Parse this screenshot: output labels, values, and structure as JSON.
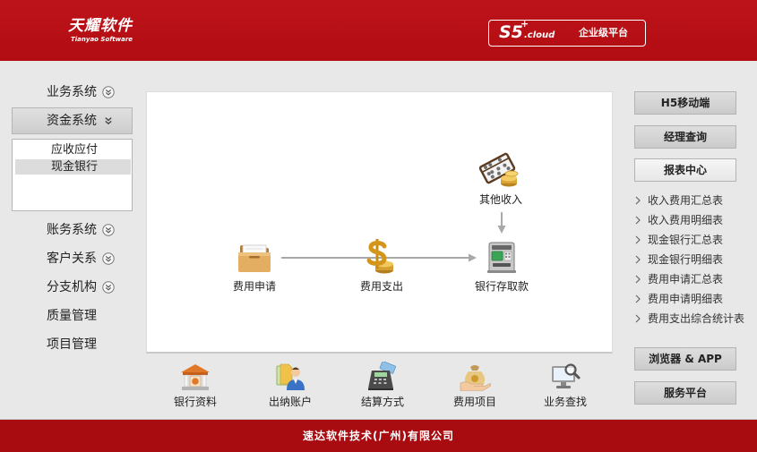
{
  "colors": {
    "brand_red": "#b10d12",
    "footer_red": "#a80c10",
    "body_bg": "#e8e8e8",
    "arrow": "#a9a9a9"
  },
  "header": {
    "logo": {
      "title": "天耀软件",
      "subtitle": "Tianyao Software"
    },
    "badge": {
      "product": "S5",
      "superscript": "+",
      "suffix": ".cloud",
      "tagline": "企业级平台"
    }
  },
  "sidebar": {
    "items": [
      {
        "label": "业务系统",
        "icon": "chevron-circle-down-icon"
      },
      {
        "label": "资金系统",
        "icon": "double-chevron-down-icon",
        "active": true
      },
      {
        "label": "账务系统",
        "icon": "chevron-circle-down-icon"
      },
      {
        "label": "客户关系",
        "icon": "chevron-circle-down-icon"
      },
      {
        "label": "分支机构",
        "icon": "chevron-circle-down-icon"
      },
      {
        "label": "质量管理"
      },
      {
        "label": "项目管理"
      }
    ],
    "submenu": [
      {
        "label": "应收应付"
      },
      {
        "label": "现金银行",
        "selected": true
      }
    ]
  },
  "flow": {
    "nodes": [
      {
        "label": "费用申请",
        "icon": "folder-icon"
      },
      {
        "label": "费用支出",
        "icon": "dollar-coins-icon"
      },
      {
        "label": "银行存取款",
        "icon": "atm-icon"
      },
      {
        "label": "其他收入",
        "icon": "abacus-coins-icon"
      }
    ],
    "edges": [
      {
        "from": 0,
        "via": 1,
        "to": 2
      },
      {
        "from": 3,
        "to": 2
      }
    ]
  },
  "shortcuts": [
    {
      "label": "银行资料",
      "icon": "bank-building-icon"
    },
    {
      "label": "出纳账户",
      "icon": "cashier-icon"
    },
    {
      "label": "结算方式",
      "icon": "card-terminal-icon"
    },
    {
      "label": "费用项目",
      "icon": "money-bag-icon"
    },
    {
      "label": "业务查找",
      "icon": "computer-search-icon"
    }
  ],
  "right_panel": {
    "top_buttons": [
      {
        "label": "H5移动端"
      },
      {
        "label": "经理查询"
      }
    ],
    "reports": {
      "title": "报表中心",
      "items": [
        "收入费用汇总表",
        "收入费用明细表",
        "现金银行汇总表",
        "现金银行明细表",
        "费用申请汇总表",
        "费用申请明细表",
        "费用支出综合统计表"
      ]
    },
    "bottom_buttons": [
      {
        "label": "浏览器 & APP"
      },
      {
        "label": "服务平台"
      }
    ]
  },
  "footer": {
    "company": "速达软件技术(广州)有限公司"
  }
}
